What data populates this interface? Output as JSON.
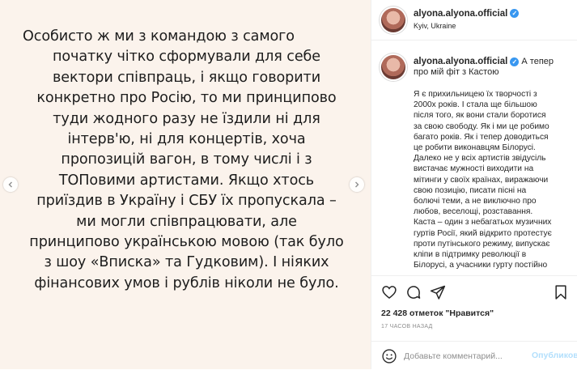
{
  "post_image": {
    "lines": [
      "Особисто ж ми з командою з самого",
      "початку чітко сформували для себе",
      "вектори співпраць, і якщо говорити",
      "конкретно про Росію, то ми принципово",
      "туди жодного разу не їздили ні для",
      "інтерв'ю, ні для концертів, хоча",
      "пропозицій вагон, в тому числі і з",
      "ТОПовими артистами. Якщо хтось",
      "приїздив в Україну і СБУ їх пропускала –",
      "ми могли співпрацювати, але",
      "принципово українською мовою (так було",
      "з шоу «Вписка» та Гудковим). І ніяких",
      "фінансових умов і рублів ніколи не було."
    ],
    "prev_icon": "chevron-left-icon",
    "next_icon": "chevron-right-icon"
  },
  "header": {
    "username": "alyona.alyona.official",
    "location": "Kyiv, Ukraine",
    "verified_icon": "verified-badge-icon"
  },
  "caption": {
    "username": "alyona.alyona.official",
    "first_text": "А тепер про мій фіт з Кастою",
    "body_lines": [
      "Я є прихильницею їх творчості з",
      "2000х років. І стала ще більшою",
      "після того, як вони стали боротися",
      "за свою свободу. Як і ми це робимо",
      "багато років. Як і тепер доводиться",
      "це робити виконавцям Білорусі.",
      "Далеко не у всіх артистів звідусіль",
      "вистачає мужності виходити на",
      "мітинги у своїх країнах, виражаючи",
      "свою позицію, писати пісні на",
      "болючі теми, а не виключно про",
      "любов, веселощі, розставання.",
      "Каста – один з небагатьох музичних",
      "гуртів Росії, який відкрито протестує",
      "проти путінського режиму, випускає",
      "кліпи в підтримку революції в",
      "Білорусі, а учасники гурту постійно"
    ]
  },
  "actions": {
    "likes": "22 428 отметок \"Нравится\"",
    "time_ago": "17 ЧАСОВ НАЗАД",
    "icons": [
      "heart-icon",
      "comment-icon",
      "share-icon",
      "bookmark-icon",
      "emoji-icon"
    ]
  },
  "comment": {
    "placeholder": "Добавьте комментарий...",
    "publish_label": "Опубликовать"
  },
  "colors": {
    "slide_background": "#fbf3ec",
    "verified": "#3897f0",
    "publish_disabled": "#b2dffc",
    "secondary_text": "#8e8e8e"
  }
}
